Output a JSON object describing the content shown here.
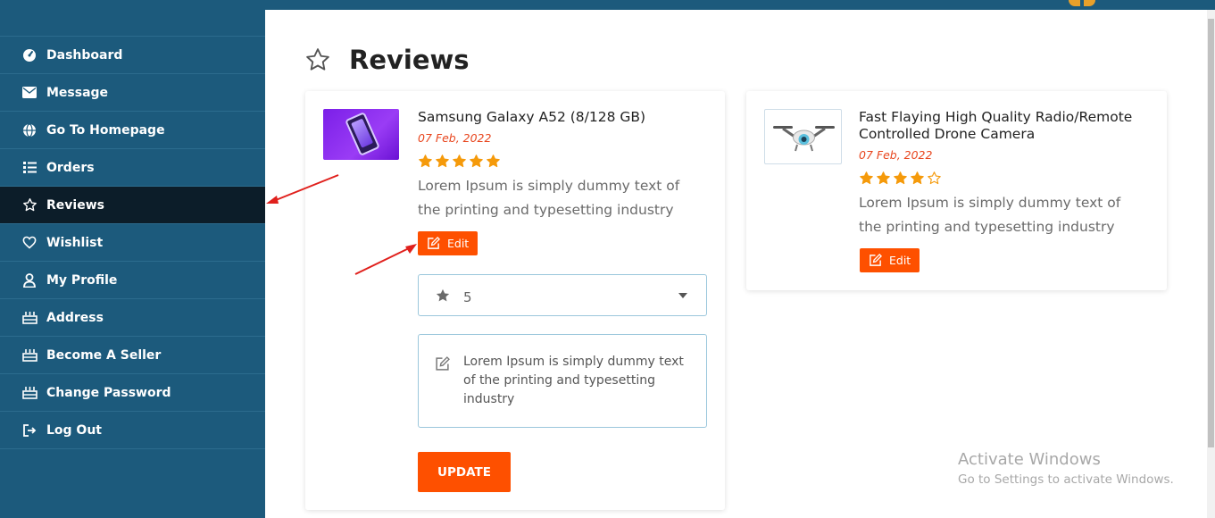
{
  "sidebar": {
    "items": [
      {
        "label": "Dashboard",
        "icon": "dashboard-icon"
      },
      {
        "label": "Message",
        "icon": "envelope-icon"
      },
      {
        "label": "Go To Homepage",
        "icon": "globe-icon"
      },
      {
        "label": "Orders",
        "icon": "list-icon"
      },
      {
        "label": "Reviews",
        "icon": "star-icon",
        "active": true
      },
      {
        "label": "Wishlist",
        "icon": "heart-icon"
      },
      {
        "label": "My Profile",
        "icon": "user-icon"
      },
      {
        "label": "Address",
        "icon": "cake-icon"
      },
      {
        "label": "Become A Seller",
        "icon": "cake-icon"
      },
      {
        "label": "Change Password",
        "icon": "cake-icon"
      },
      {
        "label": "Log Out",
        "icon": "logout-icon"
      }
    ]
  },
  "page": {
    "title": "Reviews"
  },
  "reviews": [
    {
      "product": "Samsung Galaxy A52 (8/128 GB)",
      "date": "07 Feb, 2022",
      "rating": 5,
      "text": "Lorem Ipsum is simply dummy text of the printing and typesetting industry",
      "edit_label": "Edit",
      "form": {
        "rating_value": "5",
        "comment": "Lorem Ipsum is simply dummy text of the printing and typesetting industry",
        "update_label": "UPDATE"
      }
    },
    {
      "product": "Fast Flaying High Quality Radio/Remote Controlled Drone Camera",
      "date": "07 Feb, 2022",
      "rating": 4,
      "text": "Lorem Ipsum is simply dummy text of the printing and typesetting industry",
      "edit_label": "Edit"
    }
  ],
  "watermark": {
    "line1": "Activate Windows",
    "line2": "Go to Settings to activate Windows."
  },
  "colors": {
    "sidebar": "#1c5a7c",
    "sidebar_active": "#0c1d29",
    "accent": "#fe5000",
    "star": "#f59a0b",
    "date": "#e8461e"
  }
}
